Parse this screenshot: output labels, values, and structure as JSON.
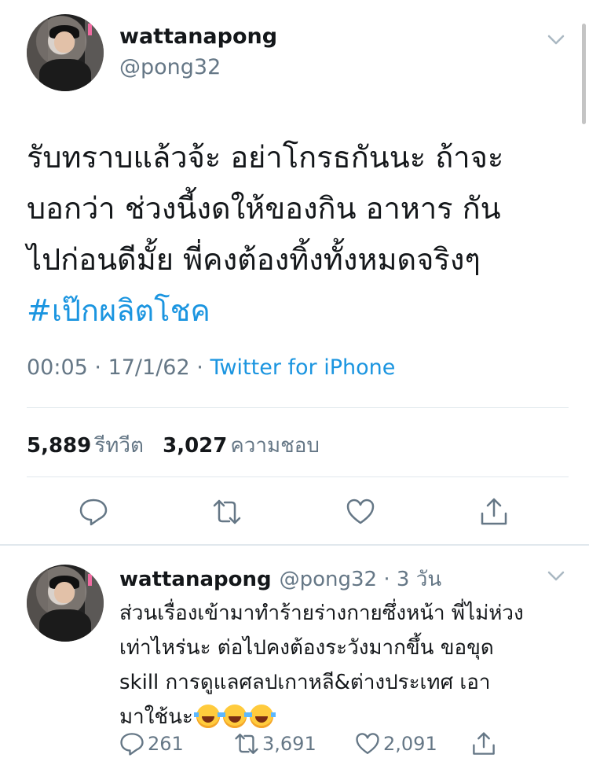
{
  "main_tweet": {
    "name": "wattanapong",
    "handle": "@pong32",
    "text_lines": [
      "รับทราบแล้วจ้ะ อย่าโกรธกันนะ ถ้าจะ",
      "บอกว่า ช่วงนี้งดให้ของกิน อาหาร กัน",
      "ไปก่อนดีมั้ย พี่คงต้องทิ้งทั้งหมดจริงๆ"
    ],
    "hashtag": "#เป๊กผลิตโชค",
    "time": "00:05",
    "date": "17/1/62",
    "source": "Twitter for iPhone",
    "retweets_count": "5,889",
    "retweets_label": "รีทวีต",
    "likes_count": "3,027",
    "likes_label": "ความชอบ"
  },
  "reply": {
    "name": "wattanapong",
    "handle": "@pong32",
    "age": "3 วัน",
    "text_lines": [
      "ส่วนเรื่องเข้ามาทำร้ายร่างกายซึ่งหน้า พี่ไม่ห่วง",
      "เท่าไหร่นะ ต่อไปคงต้องระวังมากขึ้น ขอขุด",
      "skill การดูแลศลปเกาหลี&ต่างประเทศ เอา",
      "มาใช้นะ"
    ],
    "emojis": [
      "face-with-tears-of-joy",
      "face-with-tears-of-joy",
      "face-with-tears-of-joy"
    ],
    "reply_count": "261",
    "retweet_count": "3,691",
    "like_count": "2,091"
  },
  "colors": {
    "link": "#1b95e0",
    "secondary_text": "#657786",
    "divider": "#e1e8ed"
  }
}
